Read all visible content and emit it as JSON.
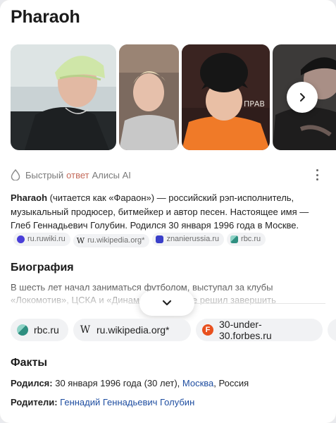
{
  "header": {
    "title": "Pharaoh"
  },
  "gallery": {
    "next_icon": "chevron-right-icon"
  },
  "ai_answer": {
    "prefix": "Быстрый",
    "accent": "ответ",
    "suffix": "Алисы AI",
    "accent_color": "#c46a5a",
    "menu_icon": "more-vertical-icon",
    "summary_bold": "Pharaoh",
    "summary_text": " (читается как «Фараон») — российский рэп-исполнитель, музыкальный продюсер, битмейкер и автор песен. Настоящее имя — Глеб Геннадьевич Голубин. Родился 30 января 1996 года в Москве.",
    "chips": [
      {
        "label": "ru.ruwiki.ru",
        "icon": "ruwiki-icon"
      },
      {
        "label": "ru.wikipedia.org*",
        "icon": "wikipedia-icon"
      },
      {
        "label": "znanierussia.ru",
        "icon": "znanie-icon"
      },
      {
        "label": "rbc.ru",
        "icon": "rbc-icon"
      }
    ]
  },
  "biography": {
    "heading": "Биография",
    "text": "В шесть лет начал заниматься футболом, выступал за клубы «Локомотив», ЦСКА и «Динамо», но в итоге решил завершить",
    "expand_icon": "chevron-down-icon"
  },
  "sources": [
    {
      "label": "rbc.ru",
      "icon": "rbc-icon"
    },
    {
      "label": "ru.wikipedia.org*",
      "icon": "wikipedia-icon"
    },
    {
      "label": "30-under-30.forbes.ru",
      "icon": "forbes-icon"
    }
  ],
  "facts": {
    "heading": "Факты",
    "born_label": "Родился:",
    "born_date": "30 января 1996 года (30 лет),",
    "born_city": "Москва",
    "born_country": ", Россия",
    "parents_label": "Родители:",
    "parents_value": "Геннадий Геннадьевич Голубин"
  },
  "colors": {
    "link": "#1f4ea1",
    "chip_bg": "#f1f2f4"
  }
}
